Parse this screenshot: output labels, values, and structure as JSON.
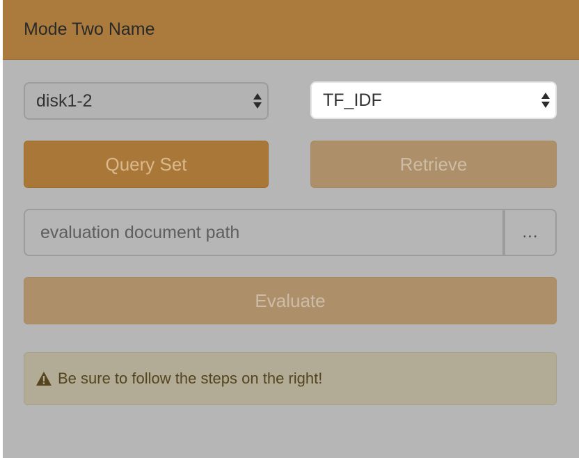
{
  "panel": {
    "title": "Mode Two Name"
  },
  "controls": {
    "collection_select": {
      "value": "disk1-2"
    },
    "model_select": {
      "value": "TF_IDF"
    },
    "query_set_label": "Query Set",
    "retrieve_label": "Retrieve",
    "path_input": {
      "placeholder": "evaluation document path",
      "value": ""
    },
    "browse_label": "...",
    "evaluate_label": "Evaluate"
  },
  "alert": {
    "icon": "warning-icon",
    "message": "Be sure to follow the steps on the right!"
  },
  "colors": {
    "header": "#aa7b3c",
    "panel_bg": "#b6b6b6",
    "primary_button": "#a97838",
    "disabled_button": "#ad9069",
    "alert_bg": "#b2ab95",
    "alert_text": "#544420"
  }
}
